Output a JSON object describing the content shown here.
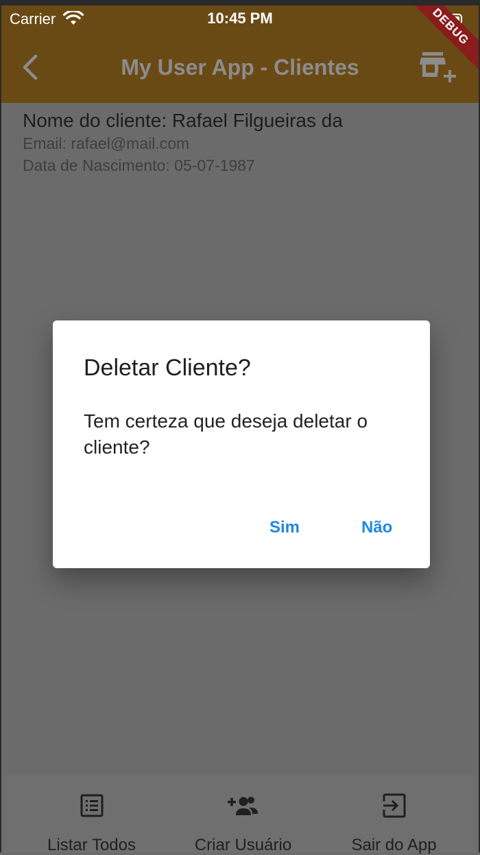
{
  "status_bar": {
    "carrier": "Carrier",
    "time": "10:45 PM",
    "icons": [
      "wifi-icon",
      "battery-icon"
    ]
  },
  "debug_banner": "DEBUG",
  "app_bar": {
    "title": "My User App - Clientes",
    "back_icon": "chevron-left-icon",
    "action_icon": "add-store-icon",
    "background_color": "#6a4a14"
  },
  "client": {
    "name": "Nome do cliente: Rafael Filgueiras da",
    "email": "Email: rafael@mail.com",
    "birth": "Data de Nascimento: 05-07-1987"
  },
  "dialog": {
    "title": "Deletar Cliente?",
    "message": "Tem certeza que deseja deletar o cliente?",
    "yes_label": "Sim",
    "no_label": "Não",
    "button_color": "#1e88e5"
  },
  "bottom_nav": {
    "items": [
      {
        "label": "Listar Todos",
        "icon": "list-icon"
      },
      {
        "label": "Criar Usuário",
        "icon": "add-group-icon"
      },
      {
        "label": "Sair do App",
        "icon": "exit-icon"
      }
    ]
  }
}
